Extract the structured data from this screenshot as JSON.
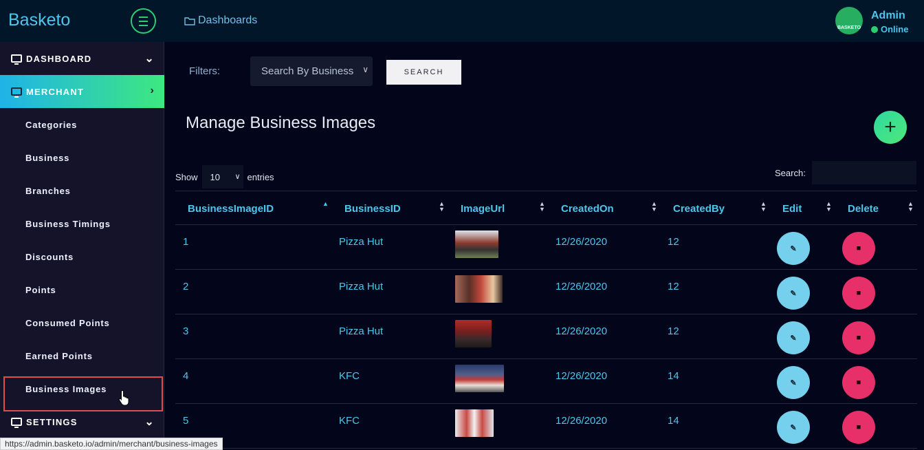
{
  "app": {
    "brand": "Basketo",
    "breadcrumb": "Dashboards"
  },
  "user": {
    "name": "Admin",
    "status": "Online",
    "avatar_text": "BASKETO"
  },
  "sidebar": {
    "dashboard": "DASHBOARD",
    "merchant": "MERCHANT",
    "items": [
      {
        "label": "Categories"
      },
      {
        "label": "Business"
      },
      {
        "label": "Branches"
      },
      {
        "label": "Business Timings"
      },
      {
        "label": "Discounts"
      },
      {
        "label": "Points"
      },
      {
        "label": "Consumed Points"
      },
      {
        "label": "Earned Points"
      },
      {
        "label": "Business Images"
      }
    ],
    "settings": "SETTINGS"
  },
  "filters": {
    "label": "Filters:",
    "business_select": "Search By Business",
    "search_button": "SEARCH"
  },
  "page": {
    "title": "Manage Business Images",
    "add_icon": "plus-icon"
  },
  "table_controls": {
    "show": "Show",
    "entries_value": "10",
    "entries": "entries",
    "search_label": "Search:"
  },
  "table": {
    "columns": [
      "BusinessImageID",
      "BusinessID",
      "ImageUrl",
      "CreatedOn",
      "CreatedBy",
      "Edit",
      "Delete"
    ],
    "rows": [
      {
        "id": "1",
        "business": "Pizza Hut",
        "created_on": "12/26/2020",
        "created_by": "12",
        "image_color": "#8a3b2e"
      },
      {
        "id": "2",
        "business": "Pizza Hut",
        "created_on": "12/26/2020",
        "created_by": "12",
        "image_color": "#7a4a3a"
      },
      {
        "id": "3",
        "business": "Pizza Hut",
        "created_on": "12/26/2020",
        "created_by": "12",
        "image_color": "#a12a2a"
      },
      {
        "id": "4",
        "business": "KFC",
        "created_on": "12/26/2020",
        "created_by": "14",
        "image_color": "#4f5f8a"
      },
      {
        "id": "5",
        "business": "KFC",
        "created_on": "12/26/2020",
        "created_by": "14",
        "image_color": "#c94b45"
      }
    ]
  },
  "statusbar": {
    "url": "https://admin.basketo.io/admin/merchant/business-images"
  },
  "colors": {
    "accent": "#4cc6ec",
    "green": "#2ecc71",
    "edit": "#74d0ec",
    "delete": "#e7306a"
  }
}
